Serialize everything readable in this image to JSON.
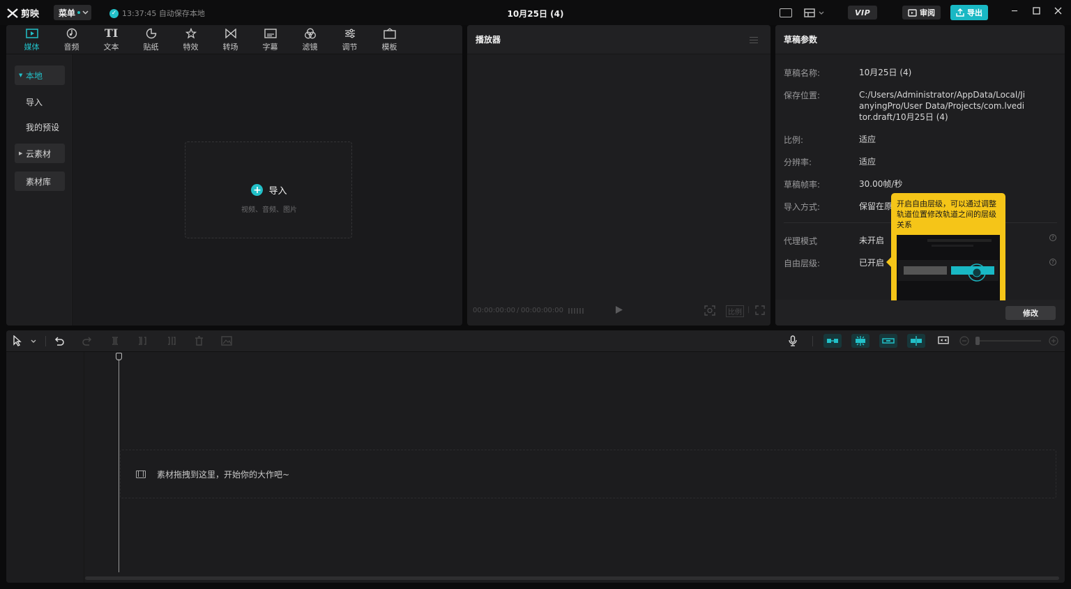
{
  "app": {
    "logo_text": "剪映",
    "menu_label": "菜单",
    "save_status": "13:37:45 自动保存本地",
    "doc_title": "10月25日 (4)",
    "vip_label": "VIP",
    "review_label": "审阅",
    "export_label": "导出"
  },
  "media_tabs": [
    {
      "label": "媒体",
      "icon": "media-icon"
    },
    {
      "label": "音频",
      "icon": "audio-icon"
    },
    {
      "label": "文本",
      "icon": "text-icon"
    },
    {
      "label": "贴纸",
      "icon": "sticker-icon"
    },
    {
      "label": "特效",
      "icon": "effects-icon"
    },
    {
      "label": "转场",
      "icon": "transition-icon"
    },
    {
      "label": "字幕",
      "icon": "subtitle-icon"
    },
    {
      "label": "滤镜",
      "icon": "filter-icon"
    },
    {
      "label": "调节",
      "icon": "adjust-icon"
    },
    {
      "label": "模板",
      "icon": "template-icon"
    }
  ],
  "media_sidebar": [
    {
      "label": "本地"
    },
    {
      "label": "导入"
    },
    {
      "label": "我的预设"
    },
    {
      "label": "云素材"
    },
    {
      "label": "素材库"
    }
  ],
  "import_box": {
    "label": "导入",
    "subtitle": "视频、音频、图片"
  },
  "player": {
    "title": "播放器",
    "current_time": "00:00:00:00",
    "separator": "/",
    "total_time": "00:00:00:00",
    "ratio_label": "比例"
  },
  "draft": {
    "title": "草稿参数",
    "rows": [
      {
        "label": "草稿名称:",
        "value": "10月25日 (4)"
      },
      {
        "label": "保存位置:",
        "value": "C:/Users/Administrator/AppData/Local/JianyingPro/User Data/Projects/com.lveditor.draft/10月25日 (4)"
      },
      {
        "label": "比例:",
        "value": "适应"
      },
      {
        "label": "分辨率:",
        "value": "适应"
      },
      {
        "label": "草稿帧率:",
        "value": "30.00帧/秒"
      },
      {
        "label": "导入方式:",
        "value": "保留在原"
      },
      {
        "label": "代理模式",
        "value": "未开启"
      },
      {
        "label": "自由层级:",
        "value": "已开启"
      }
    ],
    "modify_label": "修改"
  },
  "tooltip": {
    "text": "开启自由层级，可以通过调整轨道位置修改轨道之间的层级关系"
  },
  "timeline": {
    "drop_hint": "素材拖拽到这里，开始你的大作吧~"
  },
  "colors": {
    "accent": "#22c0c8",
    "tooltip": "#f5c518"
  }
}
